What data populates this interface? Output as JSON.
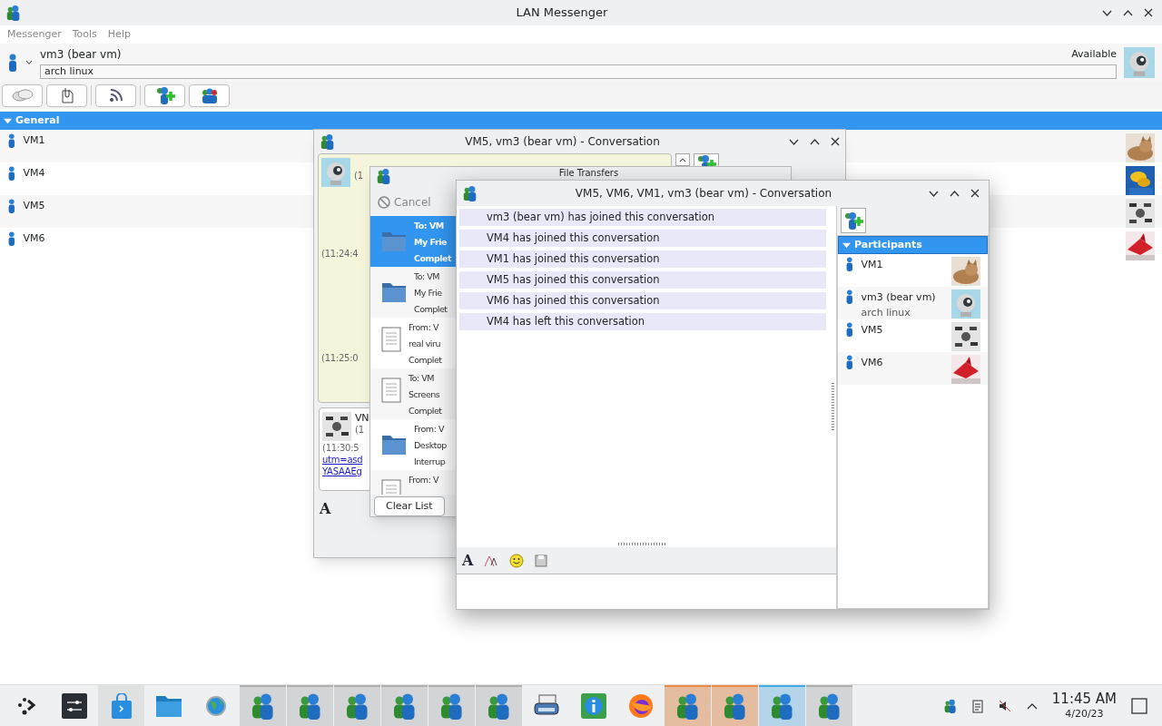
{
  "window": {
    "title": "LAN Messenger"
  },
  "menu": [
    "Messenger",
    "Tools",
    "Help"
  ],
  "user": {
    "name": "vm3 (bear vm)",
    "note": "arch linux",
    "status": "Available"
  },
  "toolbar": [
    {
      "kind": "chat"
    },
    {
      "kind": "file"
    },
    {
      "kind": "broadcast"
    },
    {
      "kind": "add"
    },
    {
      "kind": "group"
    }
  ],
  "group": {
    "label": "General",
    "expanded": true
  },
  "contacts": [
    {
      "name": "VM1"
    },
    {
      "name": "VM4"
    },
    {
      "name": "VM5"
    },
    {
      "name": "VM6"
    }
  ],
  "back_conversation": {
    "title": "VM5, vm3 (bear vm) - Conversation",
    "format_glyph": "A",
    "times": [
      "(1",
      "(11:24:4",
      "(11:25:0"
    ],
    "last_message": {
      "sender": "VN",
      "time": "(1",
      "stamp": "(11:30:5",
      "links": [
        "utm=asd",
        "YASAAEg"
      ]
    }
  },
  "file_transfers": {
    "title": "File Transfers",
    "cancel": "Cancel",
    "clear": "Clear List",
    "items": [
      {
        "kind": "folder",
        "selected": true,
        "lines": [
          "To: VM",
          "My Frie",
          "Complet"
        ]
      },
      {
        "kind": "folder",
        "selected": false,
        "lines": [
          "To: VM",
          "My Frie",
          "Complet"
        ]
      },
      {
        "kind": "file",
        "selected": false,
        "lines": [
          "From: V",
          "real viru",
          "Complet"
        ]
      },
      {
        "kind": "file",
        "selected": false,
        "lines": [
          "To: VM",
          "Screens",
          "Complet"
        ]
      },
      {
        "kind": "folder",
        "selected": false,
        "lines": [
          "From: V",
          "Desktop",
          "Interrup"
        ]
      },
      {
        "kind": "file",
        "selected": false,
        "lines": [
          "From: V"
        ]
      }
    ]
  },
  "conversation": {
    "title": "VM5, VM6, VM1, vm3 (bear vm) - Conversation",
    "format_glyph": "A",
    "events": [
      "vm3 (bear vm) has joined this conversation",
      "VM4 has joined this conversation",
      "VM1 has joined this conversation",
      "VM5 has joined this conversation",
      "VM6 has joined this conversation",
      "VM4 has left this conversation"
    ],
    "participants_label": "Participants",
    "participants_expanded": true,
    "participants": [
      {
        "name": "VM1"
      },
      {
        "name": "vm3 (bear vm)",
        "note": "arch linux"
      },
      {
        "name": "VM5"
      },
      {
        "name": "VM6"
      }
    ]
  },
  "taskbar": {
    "tasks": [
      {
        "kind": "launcher",
        "open": false,
        "hovered": false,
        "attention": false,
        "selected": false
      },
      {
        "kind": "settings",
        "open": false,
        "hovered": false,
        "attention": false,
        "selected": false
      },
      {
        "kind": "store",
        "open": false,
        "hovered": true,
        "attention": false,
        "selected": false
      },
      {
        "kind": "files",
        "open": false,
        "hovered": false,
        "attention": false,
        "selected": false
      },
      {
        "kind": "globe",
        "open": false,
        "hovered": false,
        "attention": false,
        "selected": false
      },
      {
        "kind": "messenger",
        "open": true,
        "hovered": false,
        "attention": false,
        "selected": false
      },
      {
        "kind": "messenger",
        "open": true,
        "hovered": false,
        "attention": false,
        "selected": false
      },
      {
        "kind": "messenger",
        "open": true,
        "hovered": false,
        "attention": false,
        "selected": false
      },
      {
        "kind": "messenger",
        "open": true,
        "hovered": false,
        "attention": false,
        "selected": false
      },
      {
        "kind": "messenger",
        "open": true,
        "hovered": false,
        "attention": false,
        "selected": false
      },
      {
        "kind": "messenger",
        "open": true,
        "hovered": false,
        "attention": false,
        "selected": false
      },
      {
        "kind": "printer",
        "open": false,
        "hovered": false,
        "attention": false,
        "selected": false
      },
      {
        "kind": "info",
        "open": false,
        "hovered": false,
        "attention": false,
        "selected": false
      },
      {
        "kind": "firefox",
        "open": false,
        "hovered": false,
        "attention": false,
        "selected": false
      },
      {
        "kind": "messenger",
        "open": true,
        "hovered": false,
        "attention": true,
        "selected": false
      },
      {
        "kind": "messenger",
        "open": true,
        "hovered": false,
        "attention": true,
        "selected": false
      },
      {
        "kind": "messenger",
        "open": true,
        "hovered": false,
        "attention": false,
        "selected": true
      },
      {
        "kind": "messenger",
        "open": true,
        "hovered": false,
        "attention": false,
        "selected": false
      }
    ],
    "time": "11:45 AM",
    "date": "4/20/23"
  }
}
